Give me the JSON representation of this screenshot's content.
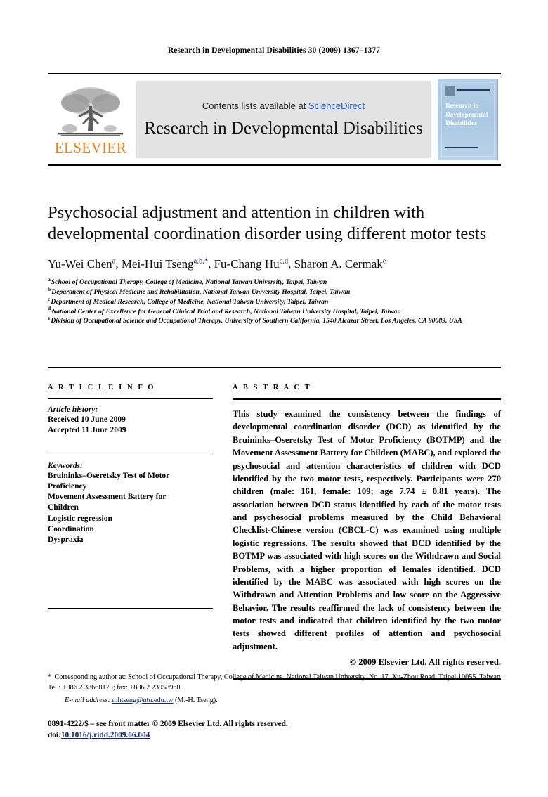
{
  "running_head": "Research in Developmental Disabilities 30 (2009) 1367–1377",
  "masthead": {
    "publisher_wordmark": "ELSEVIER",
    "contents_prefix": "Contents lists available at ",
    "contents_link": "ScienceDirect",
    "journal_title": "Research in Developmental Disabilities",
    "cover_title": "Research in Developmental Disabilities"
  },
  "article": {
    "title": "Psychosocial adjustment and attention in children with developmental coordination disorder using different motor tests",
    "authors_plain": "Yu-Wei Chen a, Mei-Hui Tseng a,b,*, Fu-Chang Hu c,d, Sharon A. Cermak e",
    "authors": [
      {
        "name": "Yu-Wei Chen",
        "sup": "a",
        "sep": ", "
      },
      {
        "name": "Mei-Hui Tseng",
        "sup": "a,b,*",
        "sep": ", "
      },
      {
        "name": "Fu-Chang Hu",
        "sup": "c,d",
        "sep": ", "
      },
      {
        "name": "Sharon A. Cermak",
        "sup": "e",
        "sep": ""
      }
    ],
    "affiliations": [
      {
        "marker": "a",
        "text": "School of Occupational Therapy, College of Medicine, National Taiwan University, Taipei, Taiwan"
      },
      {
        "marker": "b",
        "text": "Department of Physical Medicine and Rehabilitation, National Taiwan University Hospital, Taipei, Taiwan"
      },
      {
        "marker": "c",
        "text": "Department of Medical Research, College of Medicine, National Taiwan University, Taipei, Taiwan"
      },
      {
        "marker": "d",
        "text": "National Center of Excellence for General Clinical Trial and Research, National Taiwan University Hospital, Taipei, Taiwan"
      },
      {
        "marker": "e",
        "text": "Division of Occupational Science and Occupational Therapy, University of Southern California, 1540 Alcazar Street, Los Angeles, CA 90089, USA"
      }
    ]
  },
  "article_info": {
    "heading": "A R T I C L E   I N F O",
    "history_label": "Article history:",
    "history_lines": [
      "Received 10 June 2009",
      "Accepted 11 June 2009"
    ],
    "keywords_label": "Keywords:",
    "keywords": [
      "Bruininks–Oseretsky Test of Motor",
      "Proficiency",
      "Movement Assessment Battery for",
      "Children",
      "Logistic regression",
      "Coordination",
      "Dyspraxia"
    ]
  },
  "abstract": {
    "heading": "A B S T R A C T",
    "text": "This study examined the consistency between the findings of developmental coordination disorder (DCD) as identified by the Bruininks–Oseretsky Test of Motor Proficiency (BOTMP) and the Movement Assessment Battery for Children (MABC), and explored the psychosocial and attention characteristics of children with DCD identified by the two motor tests, respectively. Participants were 270 children (male: 161, female: 109; age 7.74 ± 0.81 years). The association between DCD status identified by each of the motor tests and psychosocial problems measured by the Child Behavioral Checklist-Chinese version (CBCL-C) was examined using multiple logistic regressions. The results showed that DCD identified by the BOTMP was associated with high scores on the Withdrawn and Social Problems, with a higher proportion of females identified. DCD identified by the MABC was associated with high scores on the Withdrawn and Attention Problems and low score on the Aggressive Behavior. The results reaffirmed the lack of consistency between the motor tests and indicated that children identified by the two motor tests showed different profiles of attention and psychosocial adjustment.",
    "copyright": "© 2009 Elsevier Ltd. All rights reserved."
  },
  "footnotes": {
    "star": "*",
    "corresponding": "Corresponding author at: School of Occupational Therapy, College of Medicine, National Taiwan University, No. 17, Xu-Zhou Road, Taipei 10055, Taiwan Tel.: +886 2 33668175; fax: +886 2 23958960.",
    "email_label": "E-mail address:",
    "email": "mhtseng@ntu.edu.tw",
    "email_suffix": "(M.-H. Tseng)."
  },
  "footer": {
    "issn_line": "0891-4222/$ – see front matter © 2009 Elsevier Ltd. All rights reserved.",
    "doi_label": "doi:",
    "doi": "10.1016/j.ridd.2009.06.004"
  },
  "colors": {
    "elsevier_orange": "#f07d1a",
    "link_blue": "#2a58c8",
    "sup_navy": "#12246b",
    "masthead_gray": "#e3e3e3",
    "cover_blue": "#a9c7e2"
  }
}
